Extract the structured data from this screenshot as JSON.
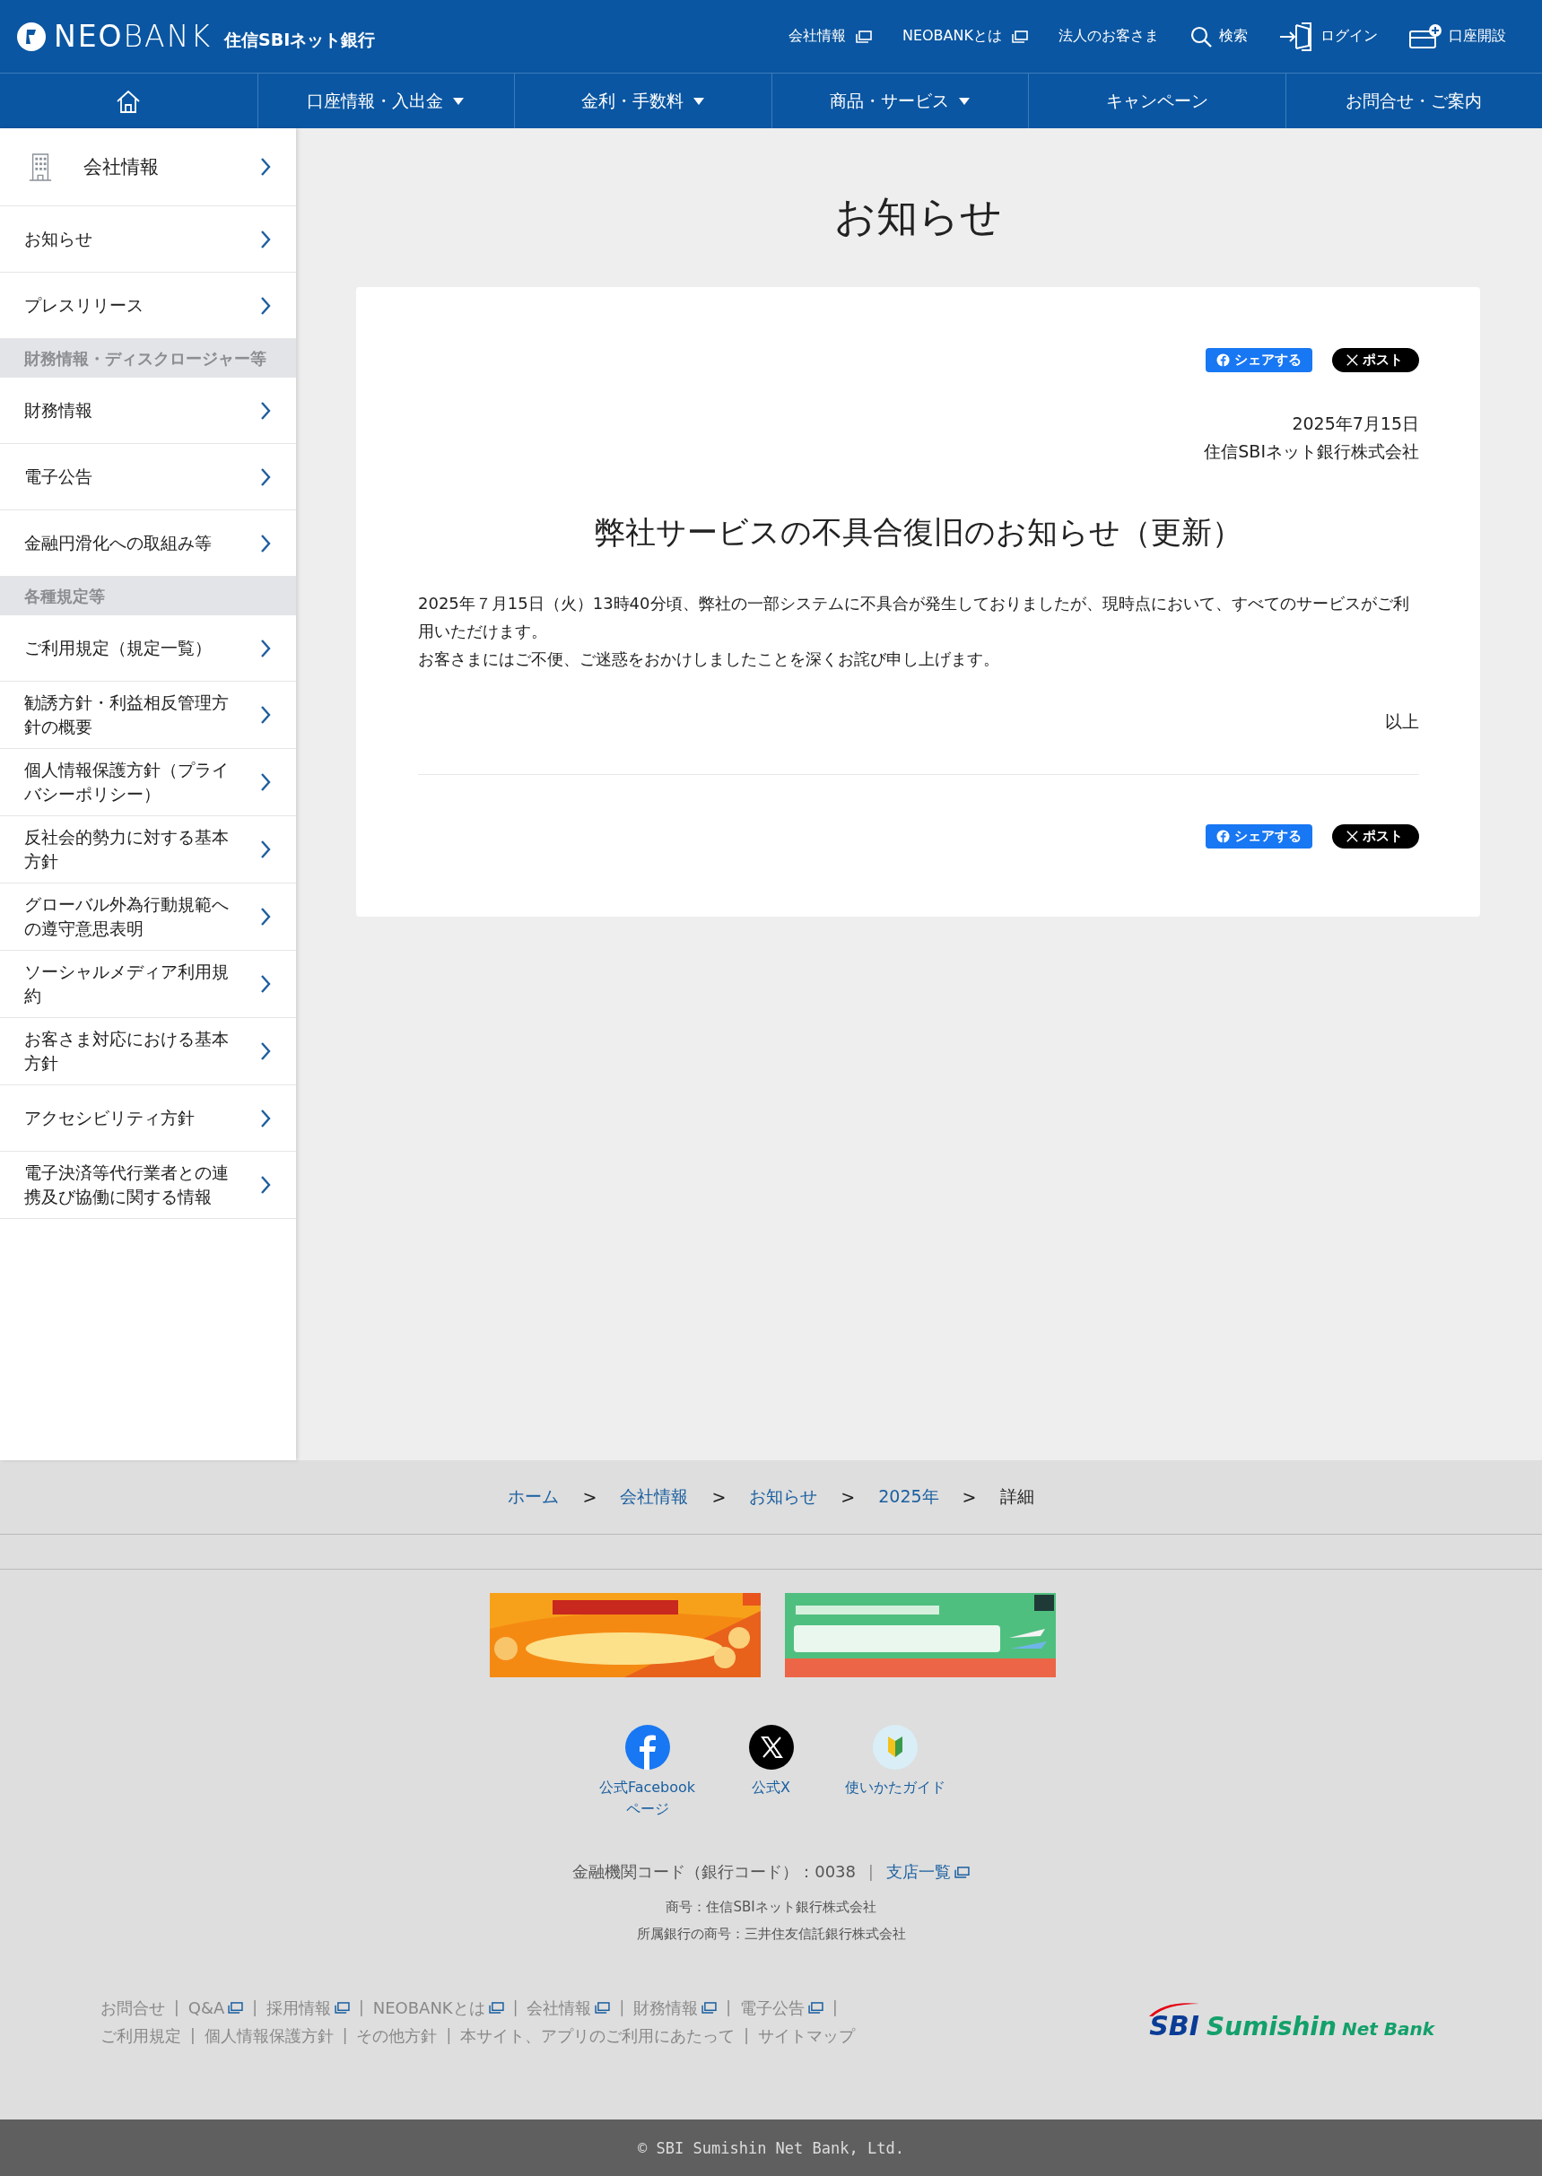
{
  "header": {
    "logo": {
      "brand": "**NEO**BANK",
      "bank_name": "住信SBIネット銀行"
    },
    "links": [
      {
        "label": "会社情報",
        "kind": "external"
      },
      {
        "label": "NEOBANKとは",
        "kind": "external"
      },
      {
        "label": "法人のお客さま",
        "kind": "plain"
      },
      {
        "label": "検索",
        "kind": "search"
      },
      {
        "label": "ログイン",
        "kind": "login"
      },
      {
        "label": "口座開設",
        "kind": "account"
      }
    ]
  },
  "nav": [
    {
      "kind": "home"
    },
    {
      "kind": "menu",
      "label": "口座情報・入出金",
      "dropdown": true
    },
    {
      "kind": "menu",
      "label": "金利・手数料",
      "dropdown": true
    },
    {
      "kind": "menu",
      "label": "商品・サービス",
      "dropdown": true
    },
    {
      "kind": "menu",
      "label": "キャンペーン",
      "dropdown": false
    },
    {
      "kind": "menu",
      "label": "お問合せ・ご案内",
      "dropdown": false
    }
  ],
  "sidebar": [
    {
      "kind": "top",
      "label": "会社情報"
    },
    {
      "kind": "link",
      "label": "お知らせ"
    },
    {
      "kind": "link",
      "label": "プレスリリース"
    },
    {
      "kind": "heading",
      "label": "財務情報・ディスクロージャー等"
    },
    {
      "kind": "link",
      "label": "財務情報"
    },
    {
      "kind": "link",
      "label": "電子公告"
    },
    {
      "kind": "link",
      "label": "金融円滑化への取組み等"
    },
    {
      "kind": "heading",
      "label": "各種規定等"
    },
    {
      "kind": "link",
      "label": "ご利用規定（規定一覧）"
    },
    {
      "kind": "link",
      "label": "勧誘方針・利益相反管理方針の概要"
    },
    {
      "kind": "link",
      "label": "個人情報保護方針（プライバシーポリシー）"
    },
    {
      "kind": "link",
      "label": "反社会的勢力に対する基本方針"
    },
    {
      "kind": "link",
      "label": "グローバル外為行動規範への遵守意思表明"
    },
    {
      "kind": "link",
      "label": "ソーシャルメディア利用規約"
    },
    {
      "kind": "link",
      "label": "お客さま対応における基本方針"
    },
    {
      "kind": "link",
      "label": "アクセシビリティ方針"
    },
    {
      "kind": "link",
      "label": "電子決済等代行業者との連携及び協働に関する情報"
    }
  ],
  "page_title": "お知らせ",
  "article": {
    "share_top": [
      {
        "kind": "facebook",
        "label": "シェアする"
      },
      {
        "kind": "x",
        "label": "ポスト"
      }
    ],
    "date": "2025年7月15日",
    "company": "住信SBIネット銀行株式会社",
    "headline": "弊社サービスの不具合復旧のお知らせ（更新）",
    "body": [
      "2025年７月15日（火）13時40分頃、弊社の一部システムに不具合が発生しておりましたが、現時点において、すべてのサービスがご利用いただけます。",
      "お客さまにはご不便、ご迷惑をおかけしましたことを深くお詫び申し上げます。"
    ],
    "closing": "以上",
    "share_bottom": [
      {
        "kind": "facebook",
        "label": "シェアする"
      },
      {
        "kind": "x",
        "label": "ポスト"
      }
    ]
  },
  "breadcrumb": [
    {
      "kind": "link",
      "label": "ホーム"
    },
    {
      "kind": "separator",
      "label": ">"
    },
    {
      "kind": "link",
      "label": "会社情報"
    },
    {
      "kind": "separator",
      "label": ">"
    },
    {
      "kind": "link",
      "label": "お知らせ"
    },
    {
      "kind": "separator",
      "label": ">"
    },
    {
      "kind": "link",
      "label": "2025年"
    },
    {
      "kind": "separator",
      "label": ">"
    },
    {
      "kind": "current",
      "label": "詳細"
    }
  ],
  "banners": [
    {
      "kind": "picture"
    },
    {
      "kind": "picture"
    }
  ],
  "social": [
    {
      "kind": "facebook",
      "label": "公式Facebookページ"
    },
    {
      "kind": "x",
      "label": "公式X"
    },
    {
      "kind": "guide",
      "label": "使いかたガイド"
    }
  ],
  "bank_code": {
    "text": "金融機関コード（銀行コード）：0038",
    "separator": "|",
    "link": "支店一覧"
  },
  "company_names": [
    "商号：住信SBIネット銀行株式会社",
    "所属銀行の商号：三井住友信託銀行株式会社"
  ],
  "footer_links": [
    [
      {
        "kind": "link",
        "label": "お問合せ",
        "external": false
      },
      {
        "kind": "separator",
        "label": "|"
      },
      {
        "kind": "link",
        "label": "Q&A",
        "external": true
      },
      {
        "kind": "separator",
        "label": "|"
      },
      {
        "kind": "link",
        "label": "採用情報",
        "external": true
      },
      {
        "kind": "separator",
        "label": "|"
      },
      {
        "kind": "link",
        "label": "NEOBANKとは",
        "external": true
      },
      {
        "kind": "separator",
        "label": "|"
      },
      {
        "kind": "link",
        "label": "会社情報",
        "external": true
      },
      {
        "kind": "separator",
        "label": "|"
      },
      {
        "kind": "link",
        "label": "財務情報",
        "external": true
      },
      {
        "kind": "separator",
        "label": "|"
      },
      {
        "kind": "link",
        "label": "電子公告",
        "external": true
      },
      {
        "kind": "separator",
        "label": "|"
      }
    ],
    [
      {
        "kind": "link",
        "label": "ご利用規定",
        "external": false
      },
      {
        "kind": "separator",
        "label": "|"
      },
      {
        "kind": "link",
        "label": "個人情報保護方針",
        "external": false
      },
      {
        "kind": "separator",
        "label": "|"
      },
      {
        "kind": "link",
        "label": "その他方針",
        "external": false
      },
      {
        "kind": "separator",
        "label": "|"
      },
      {
        "kind": "link",
        "label": "本サイト、アプリのご利用にあたって",
        "external": false
      },
      {
        "kind": "separator",
        "label": "|"
      },
      {
        "kind": "link",
        "label": "サイトマップ",
        "external": false
      }
    ]
  ],
  "footer_logo": {
    "mark": "SBI",
    "name": "Sumishin",
    "suffix": "Net Bank"
  },
  "copyright": "© SBI Sumishin Net Bank, Ltd."
}
